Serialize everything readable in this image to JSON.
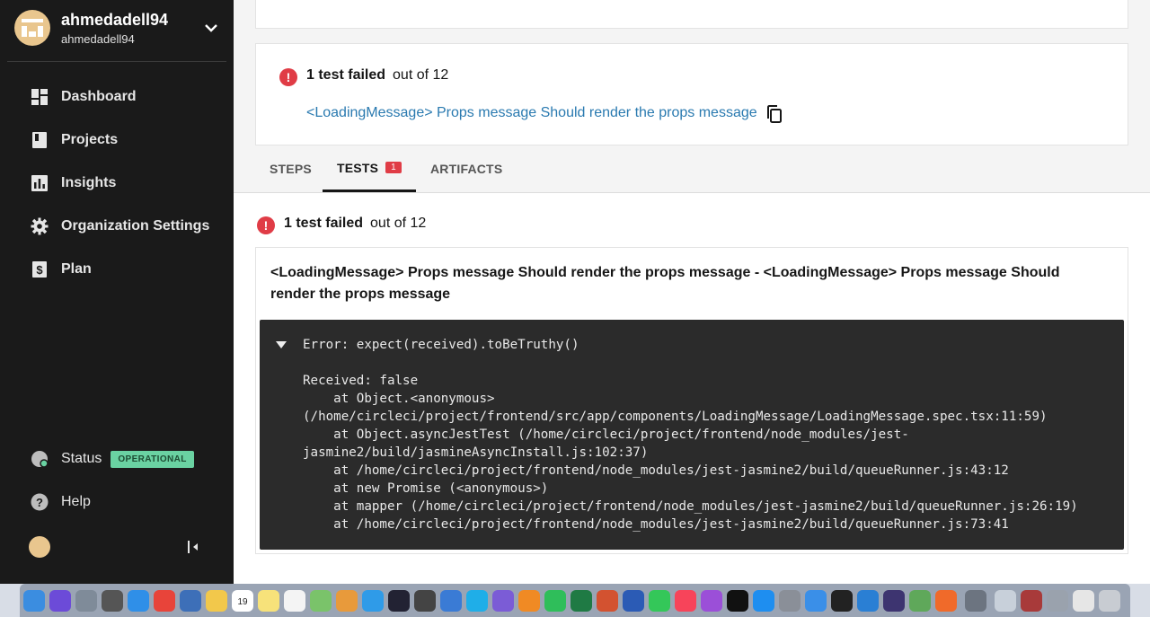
{
  "sidebar": {
    "username": "ahmedadell94",
    "org_name": "ahmedadell94",
    "nav": [
      {
        "label": "Dashboard",
        "icon": "dashboard-icon"
      },
      {
        "label": "Projects",
        "icon": "projects-icon"
      },
      {
        "label": "Insights",
        "icon": "insights-icon"
      },
      {
        "label": "Organization Settings",
        "icon": "gear-icon"
      },
      {
        "label": "Plan",
        "icon": "plan-icon"
      }
    ],
    "status_label": "Status",
    "status_badge": "OPERATIONAL",
    "help_label": "Help"
  },
  "summary": {
    "failed_label": "1 test failed",
    "out_of": "out of 12",
    "test_link": "<LoadingMessage> Props message Should render the props message"
  },
  "tabs": [
    {
      "label": "STEPS"
    },
    {
      "label": "TESTS",
      "count": "1"
    },
    {
      "label": "ARTIFACTS"
    }
  ],
  "tests": {
    "failed_label": "1 test failed",
    "out_of": "out of 12",
    "title": "<LoadingMessage> Props message Should render the props message - <LoadingMessage> Props message Should render the props message",
    "error_text": "Error: expect(received).toBeTruthy()\n\nReceived: false\n    at Object.<anonymous>\n(/home/circleci/project/frontend/src/app/components/LoadingMessage/LoadingMessage.spec.tsx:11:59)\n    at Object.asyncJestTest (/home/circleci/project/frontend/node_modules/jest-\njasmine2/build/jasmineAsyncInstall.js:102:37)\n    at /home/circleci/project/frontend/node_modules/jest-jasmine2/build/queueRunner.js:43:12\n    at new Promise (<anonymous>)\n    at mapper (/home/circleci/project/frontend/node_modules/jest-jasmine2/build/queueRunner.js:26:19)\n    at /home/circleci/project/frontend/node_modules/jest-jasmine2/build/queueRunner.js:73:41"
  },
  "colors": {
    "sidebar_bg": "#1a1a1a",
    "accent_fail": "#e03c46",
    "link": "#2a7ab0",
    "badge": "#6ad2a2"
  },
  "dock": {
    "calendar_day": "19",
    "icons": [
      "finder-icon",
      "siri-icon",
      "launchpad-icon",
      "help-icon",
      "safari-icon",
      "chrome-icon",
      "preview-icon",
      "notes-icon",
      "calendar-icon",
      "stickies-icon",
      "reminders-icon",
      "maps-icon",
      "photos-icon",
      "messages-icon",
      "quicktime-icon",
      "screenflow-icon",
      "quickshot-icon",
      "skype-icon",
      "viber-icon",
      "vlc-icon",
      "whatsapp-icon",
      "excel-icon",
      "powerpoint-icon",
      "word-icon",
      "facetime-icon",
      "music-icon",
      "podcasts-icon",
      "appletv-icon",
      "appstore-icon",
      "systemprefs-icon",
      "xcode-icon",
      "terminal-icon",
      "vscode-icon",
      "eclipse-icon",
      "android-studio-icon",
      "firefox-icon",
      "help2-icon",
      "finder2-icon",
      "dictionary-icon",
      "keychain-icon",
      "documents-icon",
      "trash-icon"
    ]
  }
}
